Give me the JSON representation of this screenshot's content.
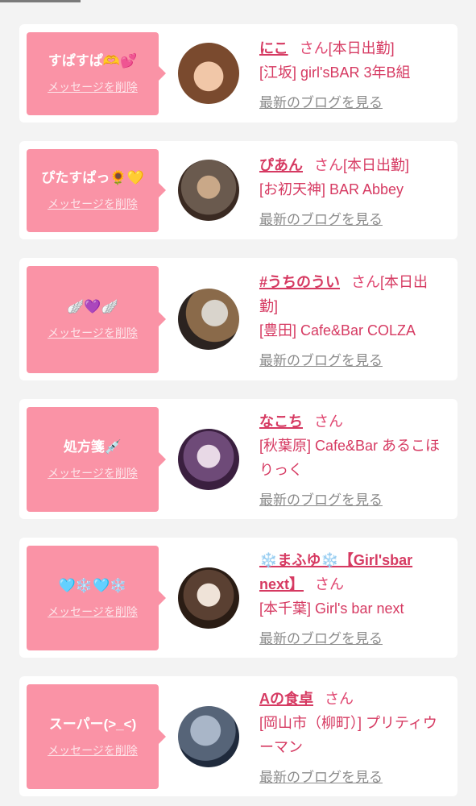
{
  "cards": [
    {
      "message": "すぱすぱ🫶💕",
      "delete_label": "メッセージを削除",
      "name": "にこ",
      "san": "さん",
      "status": "[本日出勤]",
      "shop": "[江坂] girl'sBAR 3年B組",
      "blog_label": "最新のブログを見る",
      "avatar_colors": [
        "#f1c7a8",
        "#7a4a2e"
      ]
    },
    {
      "message": "ぴたすぱっ🌻💛",
      "delete_label": "メッセージを削除",
      "name": "ぴあん",
      "san": "さん",
      "status": "[本日出勤]",
      "shop": "[お初天神] BAR Abbey",
      "blog_label": "最新のブログを見る",
      "avatar_colors": [
        "#c9a888",
        "#3a2a22"
      ]
    },
    {
      "message": "🪽💜🪽",
      "delete_label": "メッセージを削除",
      "name": "#うちのうい",
      "san": "さん",
      "status": "[本日出勤]",
      "shop": "[豊田] Cafe&Bar COLZA",
      "blog_label": "最新のブログを見る",
      "avatar_colors": [
        "#d9d4cc",
        "#2b2320"
      ]
    },
    {
      "message": "処方箋💉",
      "delete_label": "メッセージを削除",
      "name": "なこち",
      "san": "さん",
      "status": "",
      "shop": "[秋葉原] Cafe&Bar あるこほりっく",
      "blog_label": "最新のブログを見る",
      "avatar_colors": [
        "#e8d9e6",
        "#3a1f3f"
      ]
    },
    {
      "message": "🩵❄️🩵❄️",
      "delete_label": "メッセージを削除",
      "name": "❄️まふゆ❄️【Girl'sbar next】",
      "san": "さん",
      "status": "",
      "shop": "[本千葉] Girl's bar next",
      "blog_label": "最新のブログを見る",
      "avatar_colors": [
        "#efe3d8",
        "#2a1c14"
      ]
    },
    {
      "message": "スーパー(>_<)",
      "delete_label": "メッセージを削除",
      "name": "Aの食卓",
      "san": "さん",
      "status": "",
      "shop": "[岡山市（柳町）] プリティウーマン",
      "blog_label": "最新のブログを見る",
      "avatar_colors": [
        "#a9b6c8",
        "#1f2a3c"
      ]
    }
  ]
}
